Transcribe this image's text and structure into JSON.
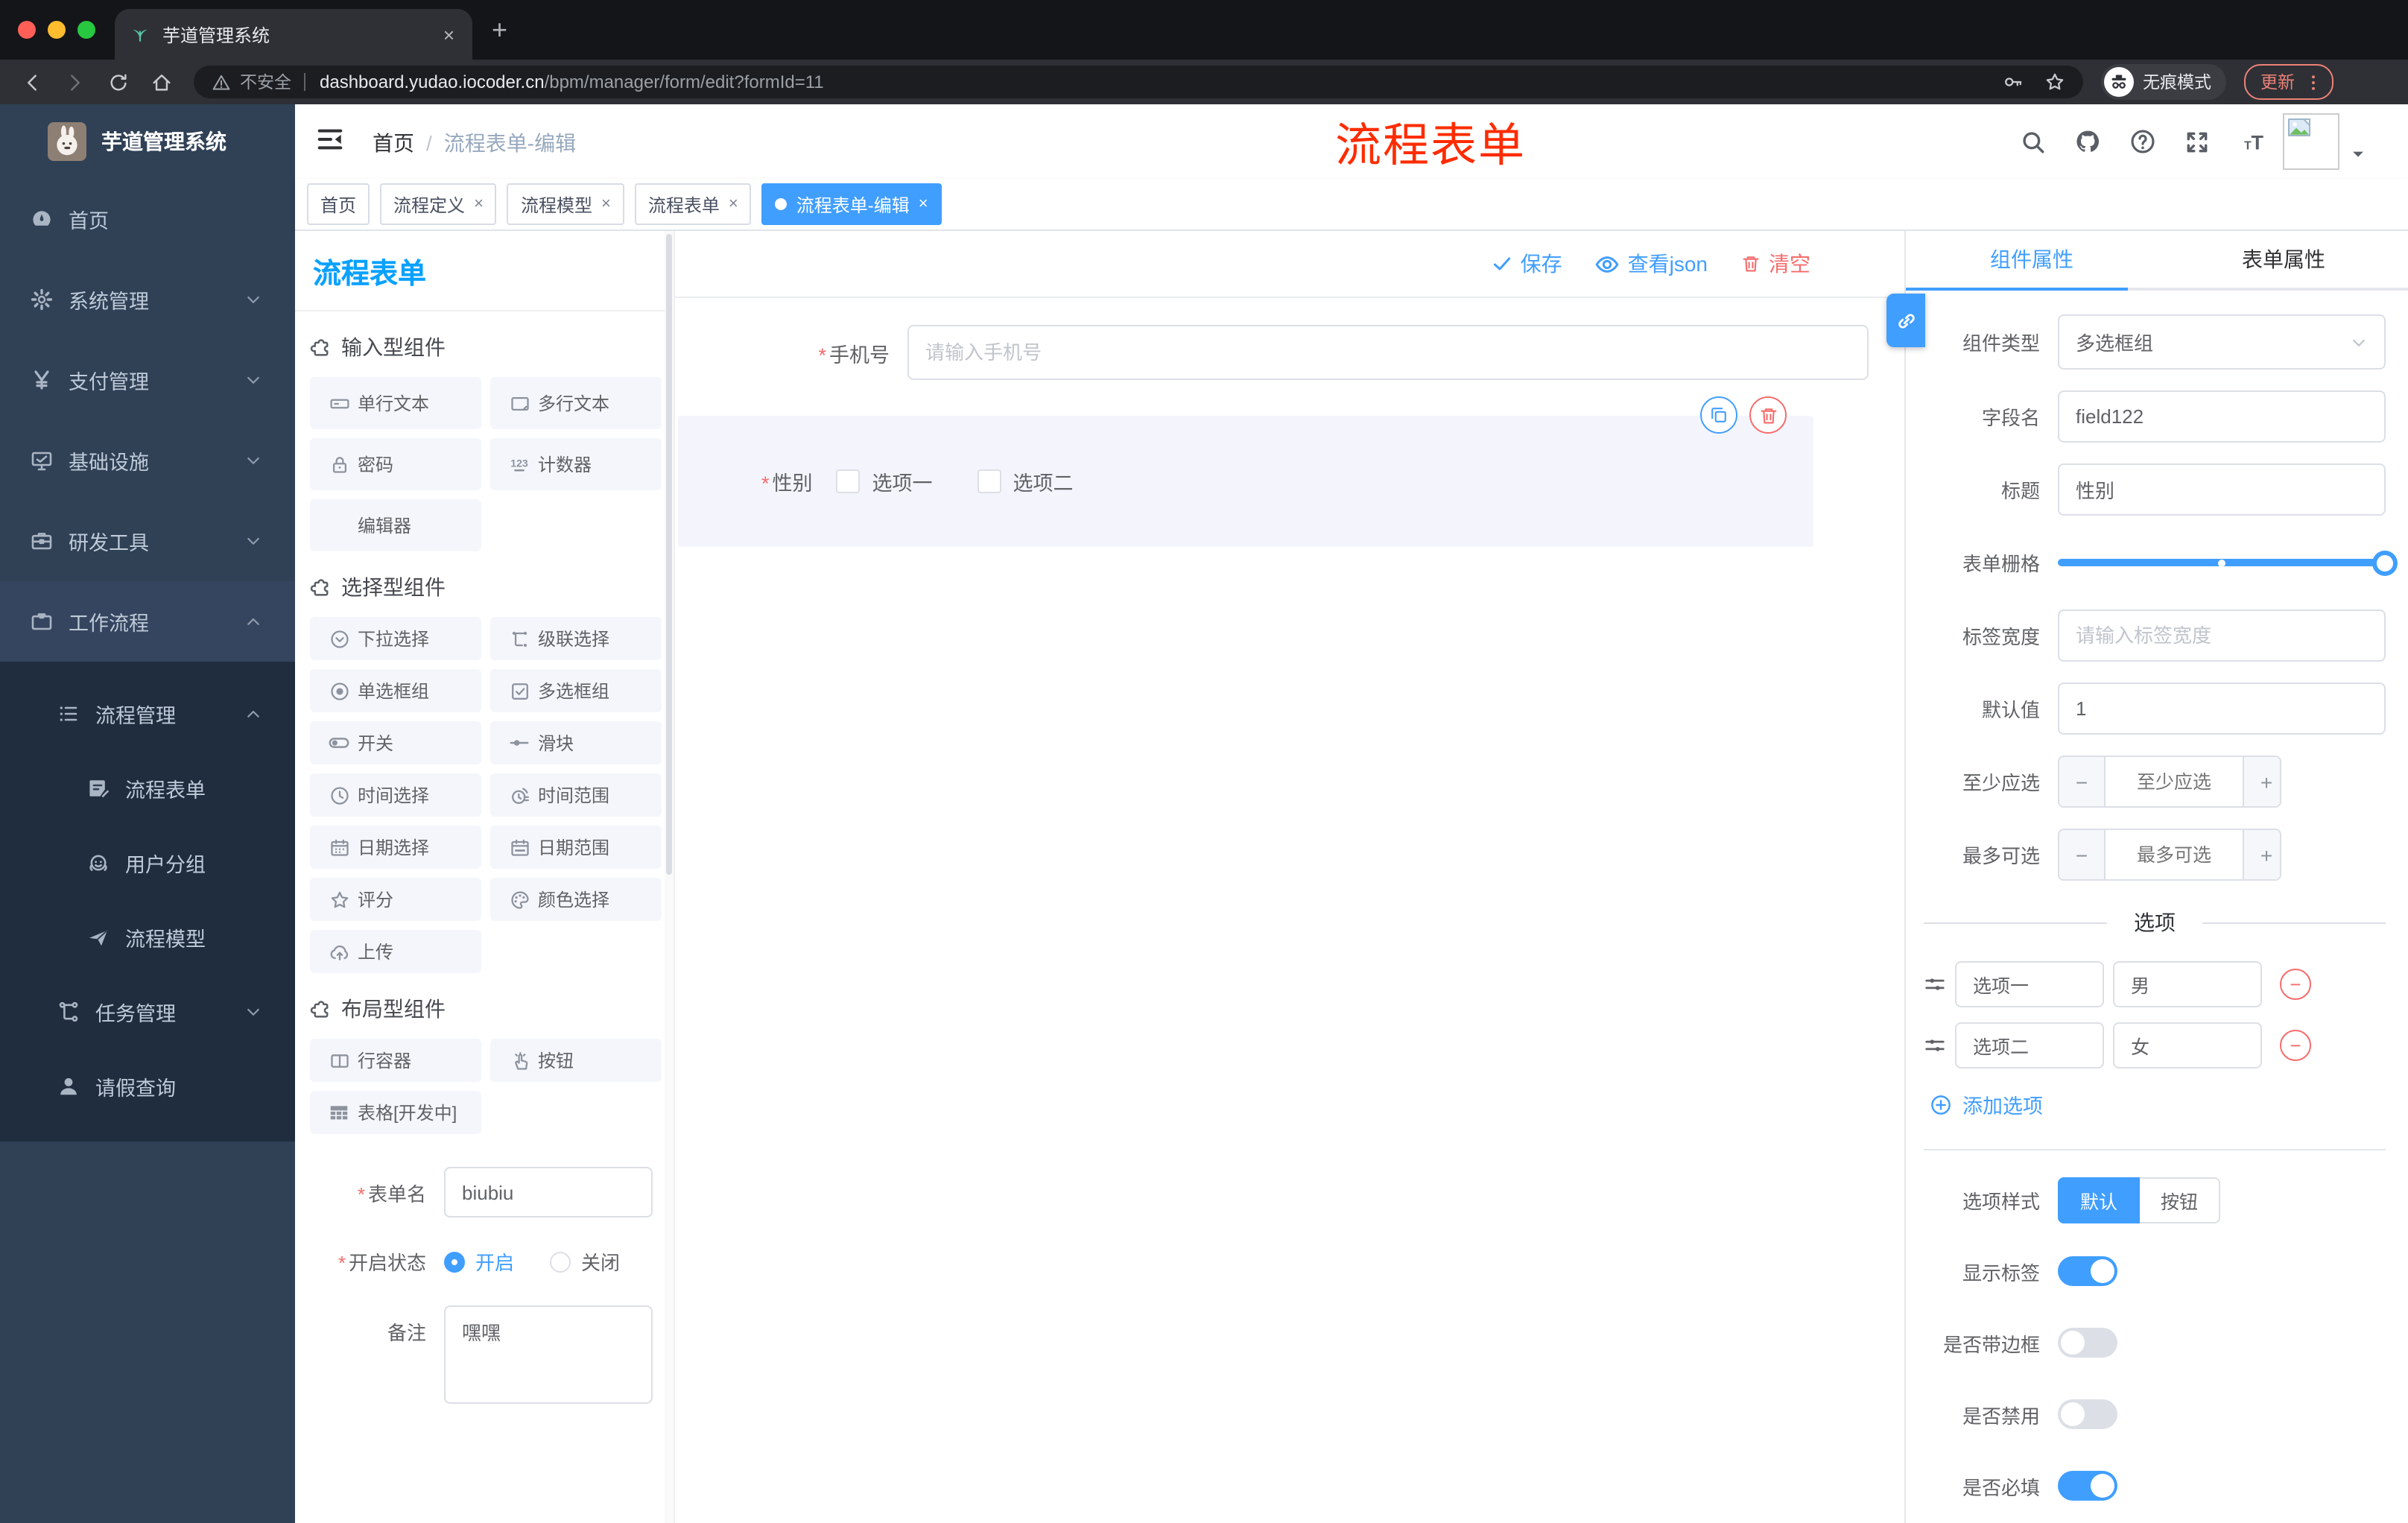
{
  "colors": {
    "accent": "#409eff",
    "danger": "#f56c6c",
    "panel_title_blue": "#0aa1ff",
    "annotation_red": "#fe2c00",
    "sidebar_bg": "#304156",
    "submenu_bg": "#1f2d3e"
  },
  "browser": {
    "tab_title": "芋道管理系统",
    "close_tab": "×",
    "new_tab": "+",
    "security_label": "不安全",
    "url_host": "dashboard.yudao.iocoder.cn",
    "url_path": "/bpm/manager/form/edit?formId=11",
    "incognito_label": "无痕模式",
    "update_label": "更新",
    "favicon": "plant-icon",
    "back_icon": "arrow-left-icon",
    "forward_icon": "arrow-right-icon",
    "reload_icon": "reload-icon",
    "home_icon": "home-icon",
    "warning_icon": "warning-triangle-icon",
    "key_icon": "key-icon",
    "bookmark_icon": "star-icon",
    "incognito_icon": "incognito-icon",
    "menu_icon": "dots-vertical-icon"
  },
  "header": {
    "fold_icon": "fold-icon",
    "breadcrumb_home": "首页",
    "breadcrumb_sep": "/",
    "breadcrumb_current": "流程表单-编辑",
    "annotation": "流程表单",
    "search_icon": "search-icon",
    "github_icon": "github-icon",
    "help_icon": "question-icon",
    "fullscreen_icon": "fullscreen-icon",
    "font_size_icon": "font-size-icon",
    "avatar_icon": "image-placeholder-icon",
    "caret_icon": "caret-down-icon"
  },
  "tag_close": "×",
  "tags": [
    {
      "label": "首页",
      "closable": false,
      "active": false
    },
    {
      "label": "流程定义",
      "closable": true,
      "active": false
    },
    {
      "label": "流程模型",
      "closable": true,
      "active": false
    },
    {
      "label": "流程表单",
      "closable": true,
      "active": false
    },
    {
      "label": "流程表单-编辑",
      "closable": true,
      "active": true
    }
  ],
  "sidebar": {
    "title": "芋道管理系统",
    "logo_icon": "rabbit-logo-icon",
    "items": [
      {
        "label": "首页",
        "icon": "gauge-icon",
        "arrow": ""
      },
      {
        "label": "系统管理",
        "icon": "gear-icon",
        "arrow": "down"
      },
      {
        "label": "支付管理",
        "icon": "yen-icon",
        "arrow": "down"
      },
      {
        "label": "基础设施",
        "icon": "monitor-icon",
        "arrow": "down"
      },
      {
        "label": "研发工具",
        "icon": "toolbox-icon",
        "arrow": "down"
      },
      {
        "label": "工作流程",
        "icon": "briefcase-icon",
        "arrow": "up"
      }
    ],
    "submenu": [
      {
        "label": "流程管理",
        "icon": "list-icon",
        "arrow": "up",
        "level": 2
      },
      {
        "label": "流程表单",
        "icon": "doc-edit-icon",
        "arrow": "",
        "level": 3
      },
      {
        "label": "用户分组",
        "icon": "robot-icon",
        "arrow": "",
        "level": 3
      },
      {
        "label": "流程模型",
        "icon": "plane-icon",
        "arrow": "",
        "level": 3
      },
      {
        "label": "任务管理",
        "icon": "tree-icon",
        "arrow": "down",
        "level": 2
      },
      {
        "label": "请假查询",
        "icon": "user-icon",
        "arrow": "",
        "level": 2
      }
    ]
  },
  "panel": {
    "title": "流程表单",
    "section_icon": "puzzle-icon",
    "sections": [
      {
        "title": "输入型组件",
        "items": [
          {
            "label": "单行文本",
            "icon": "input-icon"
          },
          {
            "label": "多行文本",
            "icon": "textarea-icon"
          },
          {
            "label": "密码",
            "icon": "lock-icon"
          },
          {
            "label": "计数器",
            "icon": "counter-icon"
          },
          {
            "label": "编辑器",
            "icon": ""
          }
        ]
      },
      {
        "title": "选择型组件",
        "items": [
          {
            "label": "下拉选择",
            "icon": "select-icon"
          },
          {
            "label": "级联选择",
            "icon": "cascade-icon"
          },
          {
            "label": "单选框组",
            "icon": "radio-icon"
          },
          {
            "label": "多选框组",
            "icon": "checkbox-icon"
          },
          {
            "label": "开关",
            "icon": "switch-icon"
          },
          {
            "label": "滑块",
            "icon": "slider-icon"
          },
          {
            "label": "时间选择",
            "icon": "clock-icon"
          },
          {
            "label": "时间范围",
            "icon": "time-range-icon"
          },
          {
            "label": "日期选择",
            "icon": "calendar-icon"
          },
          {
            "label": "日期范围",
            "icon": "calendar-range-icon"
          },
          {
            "label": "评分",
            "icon": "star-icon"
          },
          {
            "label": "颜色选择",
            "icon": "palette-icon"
          },
          {
            "label": "上传",
            "icon": "upload-icon"
          }
        ]
      },
      {
        "title": "布局型组件",
        "items": [
          {
            "label": "行容器",
            "icon": "columns-icon"
          },
          {
            "label": "按钮",
            "icon": "pointer-icon"
          },
          {
            "label": "表格[开发中]",
            "icon": "table-icon"
          }
        ]
      }
    ],
    "form": {
      "name_label": "表单名",
      "name_value": "biubiu",
      "status_label": "开启状态",
      "status_on": "开启",
      "status_off": "关闭",
      "remark_label": "备注",
      "remark_value": "嘿嘿"
    }
  },
  "canvas": {
    "actions": {
      "save": "保存",
      "view_json": "查看json",
      "clear": "清空"
    },
    "save_icon": "check-icon",
    "view_icon": "eye-icon",
    "clear_icon": "trash-icon",
    "copy_icon": "copy-icon",
    "delete_icon": "trash-icon",
    "phone": {
      "label": "手机号",
      "placeholder": "请输入手机号"
    },
    "gender": {
      "label": "性别",
      "option1": "选项一",
      "option2": "选项二"
    }
  },
  "inspector": {
    "tab_component": "组件属性",
    "tab_form": "表单属性",
    "link_icon": "link-icon",
    "component_type_label": "组件类型",
    "component_type_value": "多选框组",
    "field_name_label": "字段名",
    "field_name_value": "field122",
    "title_label": "标题",
    "title_value": "性别",
    "grid_label": "表单栅格",
    "label_width_label": "标签宽度",
    "label_width_placeholder": "请输入标签宽度",
    "default_label": "默认值",
    "default_value": "1",
    "min_label": "至少应选",
    "min_placeholder": "至少应选",
    "max_label": "最多可选",
    "max_placeholder": "最多可选",
    "minus": "−",
    "plus": "+",
    "options_title": "选项",
    "option_handle_icon": "drag-sliders-icon",
    "options": [
      {
        "name": "选项一",
        "value": "男"
      },
      {
        "name": "选项二",
        "value": "女"
      }
    ],
    "add_option": "添加选项",
    "add_icon": "plus-circle-icon",
    "style_label": "选项样式",
    "style_default": "默认",
    "style_button": "按钮",
    "toggles": [
      {
        "label": "显示标签",
        "on": true
      },
      {
        "label": "是否带边框",
        "on": false
      },
      {
        "label": "是否禁用",
        "on": false
      },
      {
        "label": "是否必填",
        "on": true
      }
    ]
  }
}
